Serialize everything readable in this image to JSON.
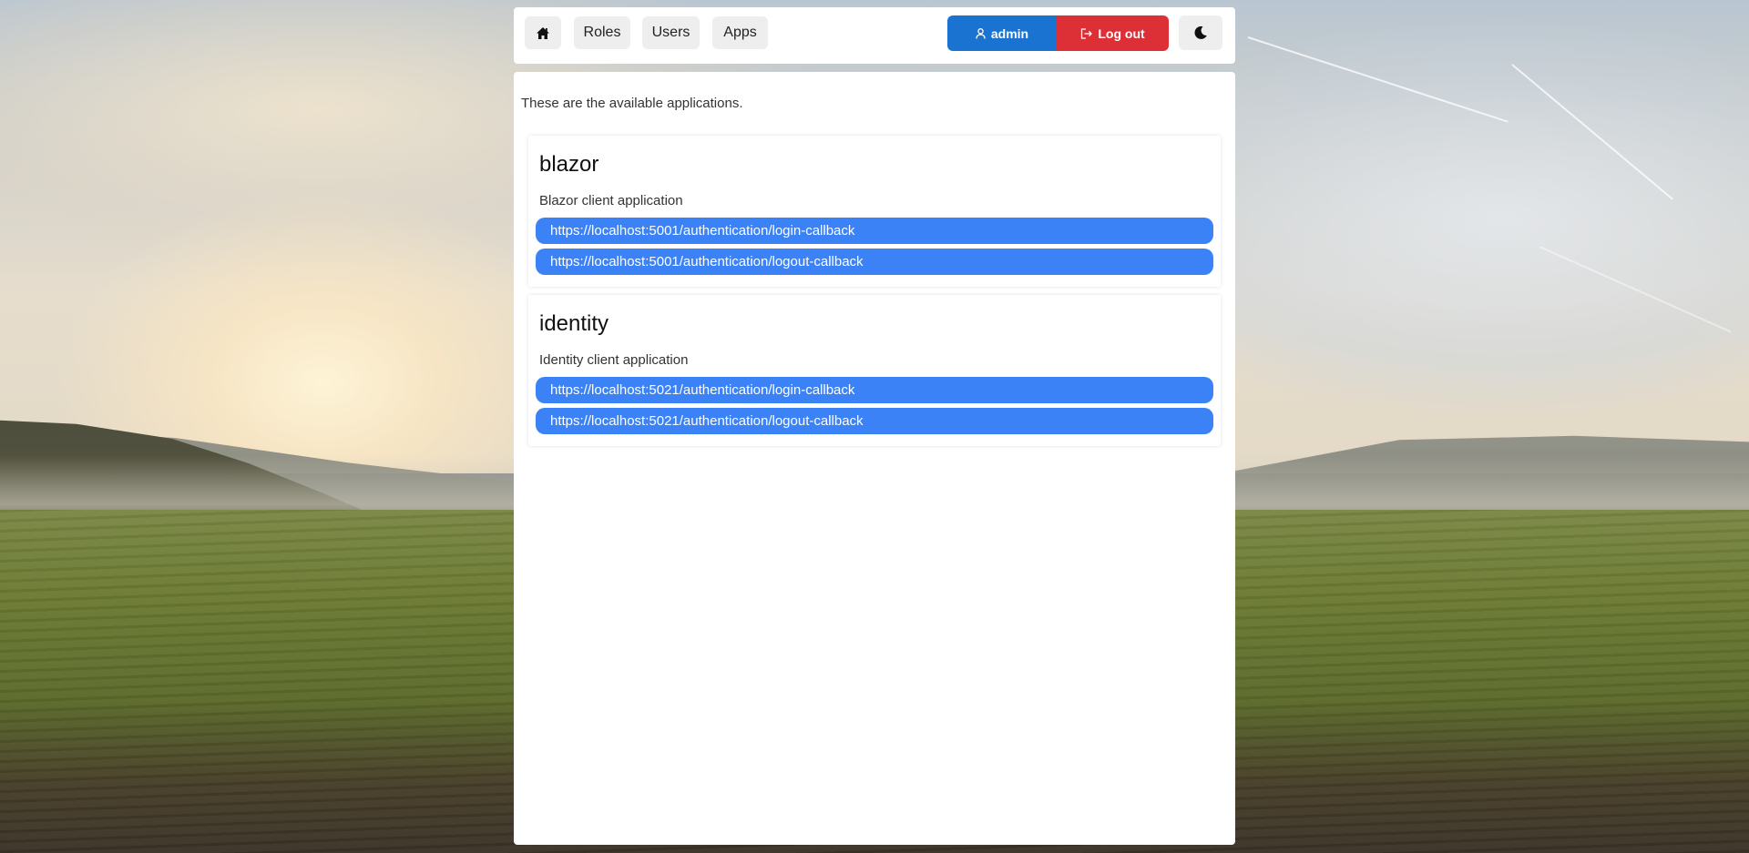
{
  "nav": {
    "home_icon": "home-icon",
    "roles_label": "Roles",
    "users_label": "Users",
    "apps_label": "Apps",
    "theme_icon": "moon-icon"
  },
  "account": {
    "user_label": "admin",
    "user_icon": "user-icon",
    "logout_label": "Log out",
    "logout_icon": "logout-icon",
    "user_color": "#1a73d1",
    "logout_color": "#dc2f36"
  },
  "main": {
    "intro": "These are the available applications.",
    "apps": [
      {
        "name": "blazor",
        "description": "Blazor client application",
        "redirect_uris": [
          "https://localhost:5001/authentication/login-callback",
          "https://localhost:5001/authentication/logout-callback"
        ]
      },
      {
        "name": "identity",
        "description": "Identity client application",
        "redirect_uris": [
          "https://localhost:5021/authentication/login-callback",
          "https://localhost:5021/authentication/logout-callback"
        ]
      }
    ],
    "uri_color": "#3b82f6"
  }
}
